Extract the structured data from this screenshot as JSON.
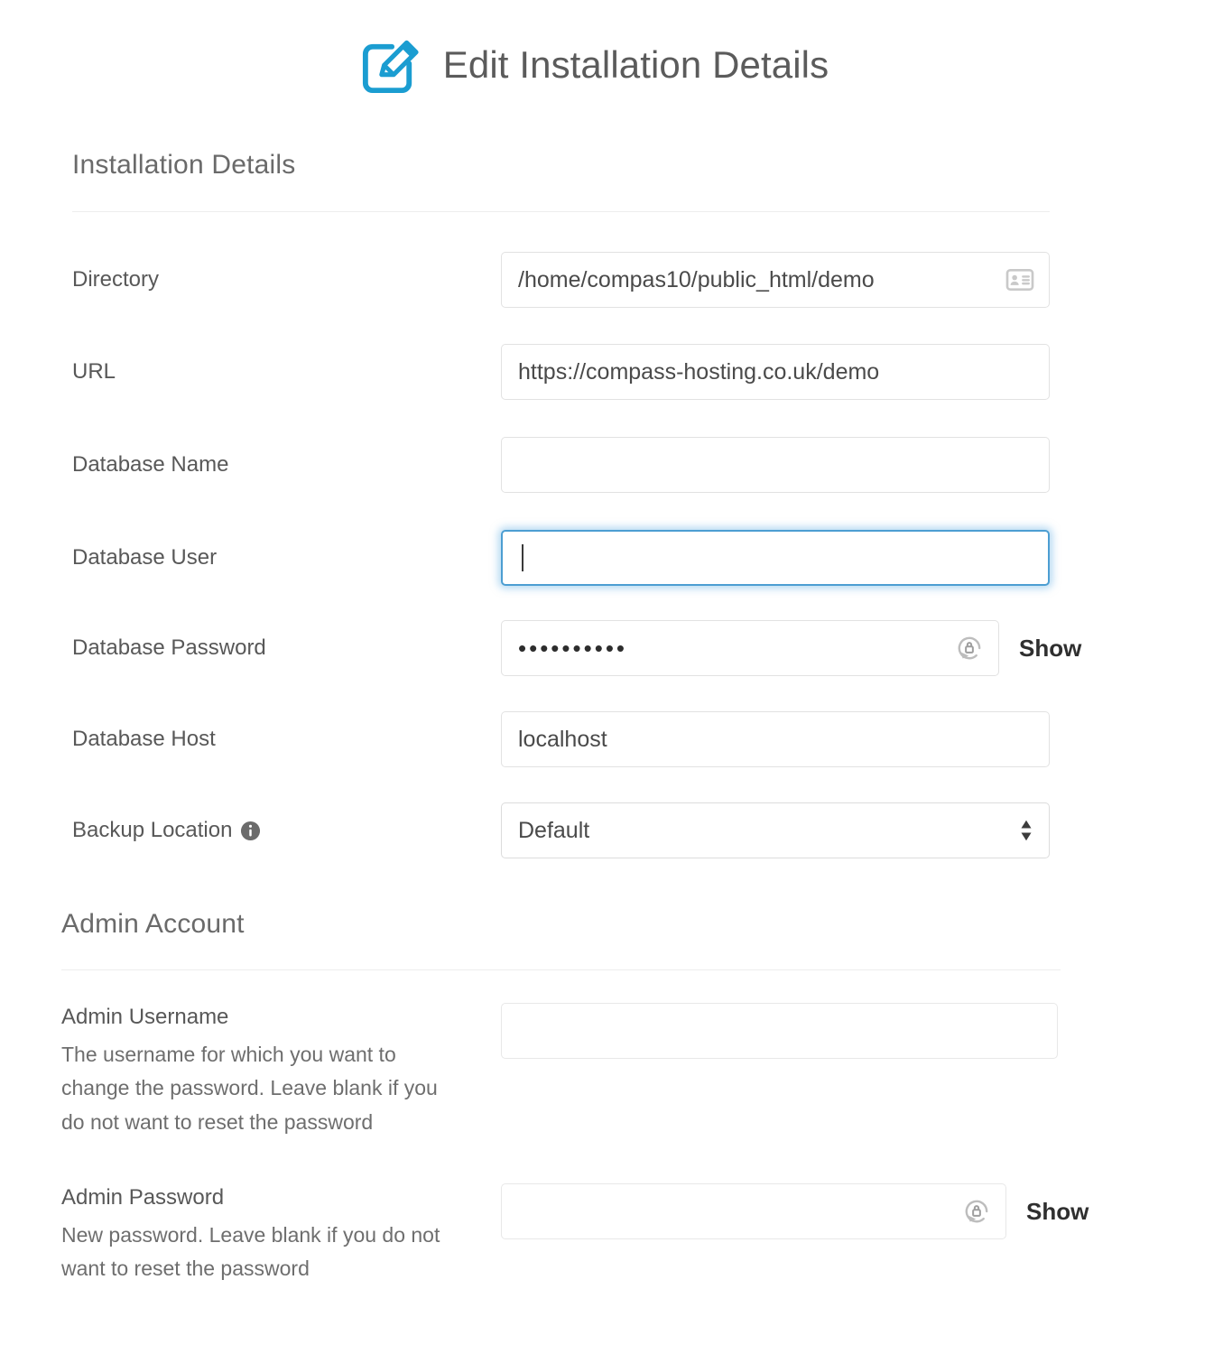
{
  "header": {
    "title": "Edit Installation Details",
    "icon": "edit-square-pencil-icon"
  },
  "sections": {
    "installation": {
      "heading": "Installation Details",
      "fields": {
        "directory": {
          "label": "Directory",
          "value": "/home/compas10/public_html/demo",
          "icon": "contact-card-icon"
        },
        "url": {
          "label": "URL",
          "value": "https://compass-hosting.co.uk/demo"
        },
        "database_name": {
          "label": "Database Name",
          "value": ""
        },
        "database_user": {
          "label": "Database User",
          "value": "",
          "focused": true
        },
        "database_password": {
          "label": "Database Password",
          "value": "••••••••••",
          "icon": "generate-password-icon",
          "toggle_label": "Show"
        },
        "database_host": {
          "label": "Database Host",
          "value": "localhost"
        },
        "backup_location": {
          "label": "Backup Location",
          "info_icon": "info-circle-icon",
          "value": "Default",
          "options": [
            "Default"
          ]
        }
      }
    },
    "admin": {
      "heading": "Admin Account",
      "fields": {
        "admin_username": {
          "label": "Admin Username",
          "help": "The username for which you want to change the password. Leave blank if you do not want to reset the password",
          "value": ""
        },
        "admin_password": {
          "label": "Admin Password",
          "help": "New password. Leave blank if you do not want to reset the password",
          "value": "",
          "icon": "generate-password-icon",
          "toggle_label": "Show"
        }
      }
    }
  },
  "colors": {
    "accent": "#1b9dd1",
    "focus_border": "#4c9ed2",
    "text": "#585858",
    "border": "#e2e2e2"
  }
}
